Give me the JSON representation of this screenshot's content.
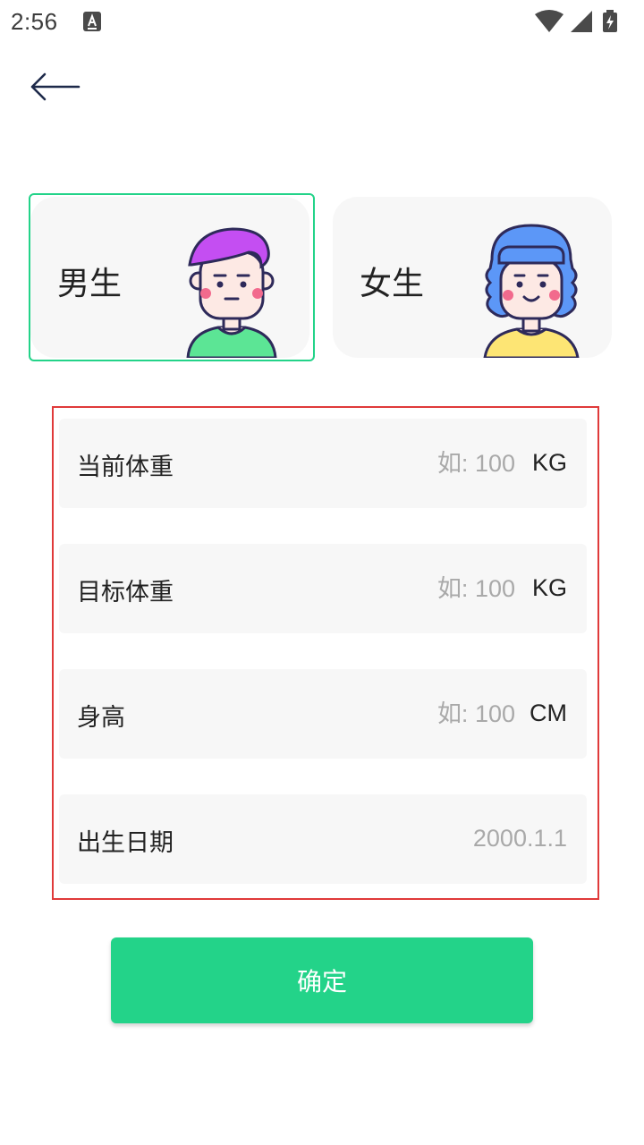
{
  "status_bar": {
    "time": "2:56",
    "left_icon": "keyboard-a-icon",
    "right_icons": [
      "wifi-icon",
      "cell-signal-icon",
      "battery-charging-icon"
    ]
  },
  "header": {
    "back_icon": "arrow-left-icon"
  },
  "gender": {
    "selected": "male",
    "male_label": "男生",
    "female_label": "女生",
    "male_avatar": "male-avatar-icon",
    "female_avatar": "female-avatar-icon"
  },
  "form": {
    "current_weight": {
      "label": "当前体重",
      "placeholder": "如: 100",
      "value": "",
      "unit": "KG"
    },
    "target_weight": {
      "label": "目标体重",
      "placeholder": "如: 100",
      "value": "",
      "unit": "KG"
    },
    "height": {
      "label": "身高",
      "placeholder": "如: 100",
      "value": "",
      "unit": "CM"
    },
    "birth_date": {
      "label": "出生日期",
      "value": "2000.1.1"
    }
  },
  "confirm_label": "确定",
  "colors": {
    "accent": "#23d389",
    "highlight_border": "#e03a3a",
    "field_bg": "#f7f7f7",
    "placeholder": "#a9a9a9"
  }
}
